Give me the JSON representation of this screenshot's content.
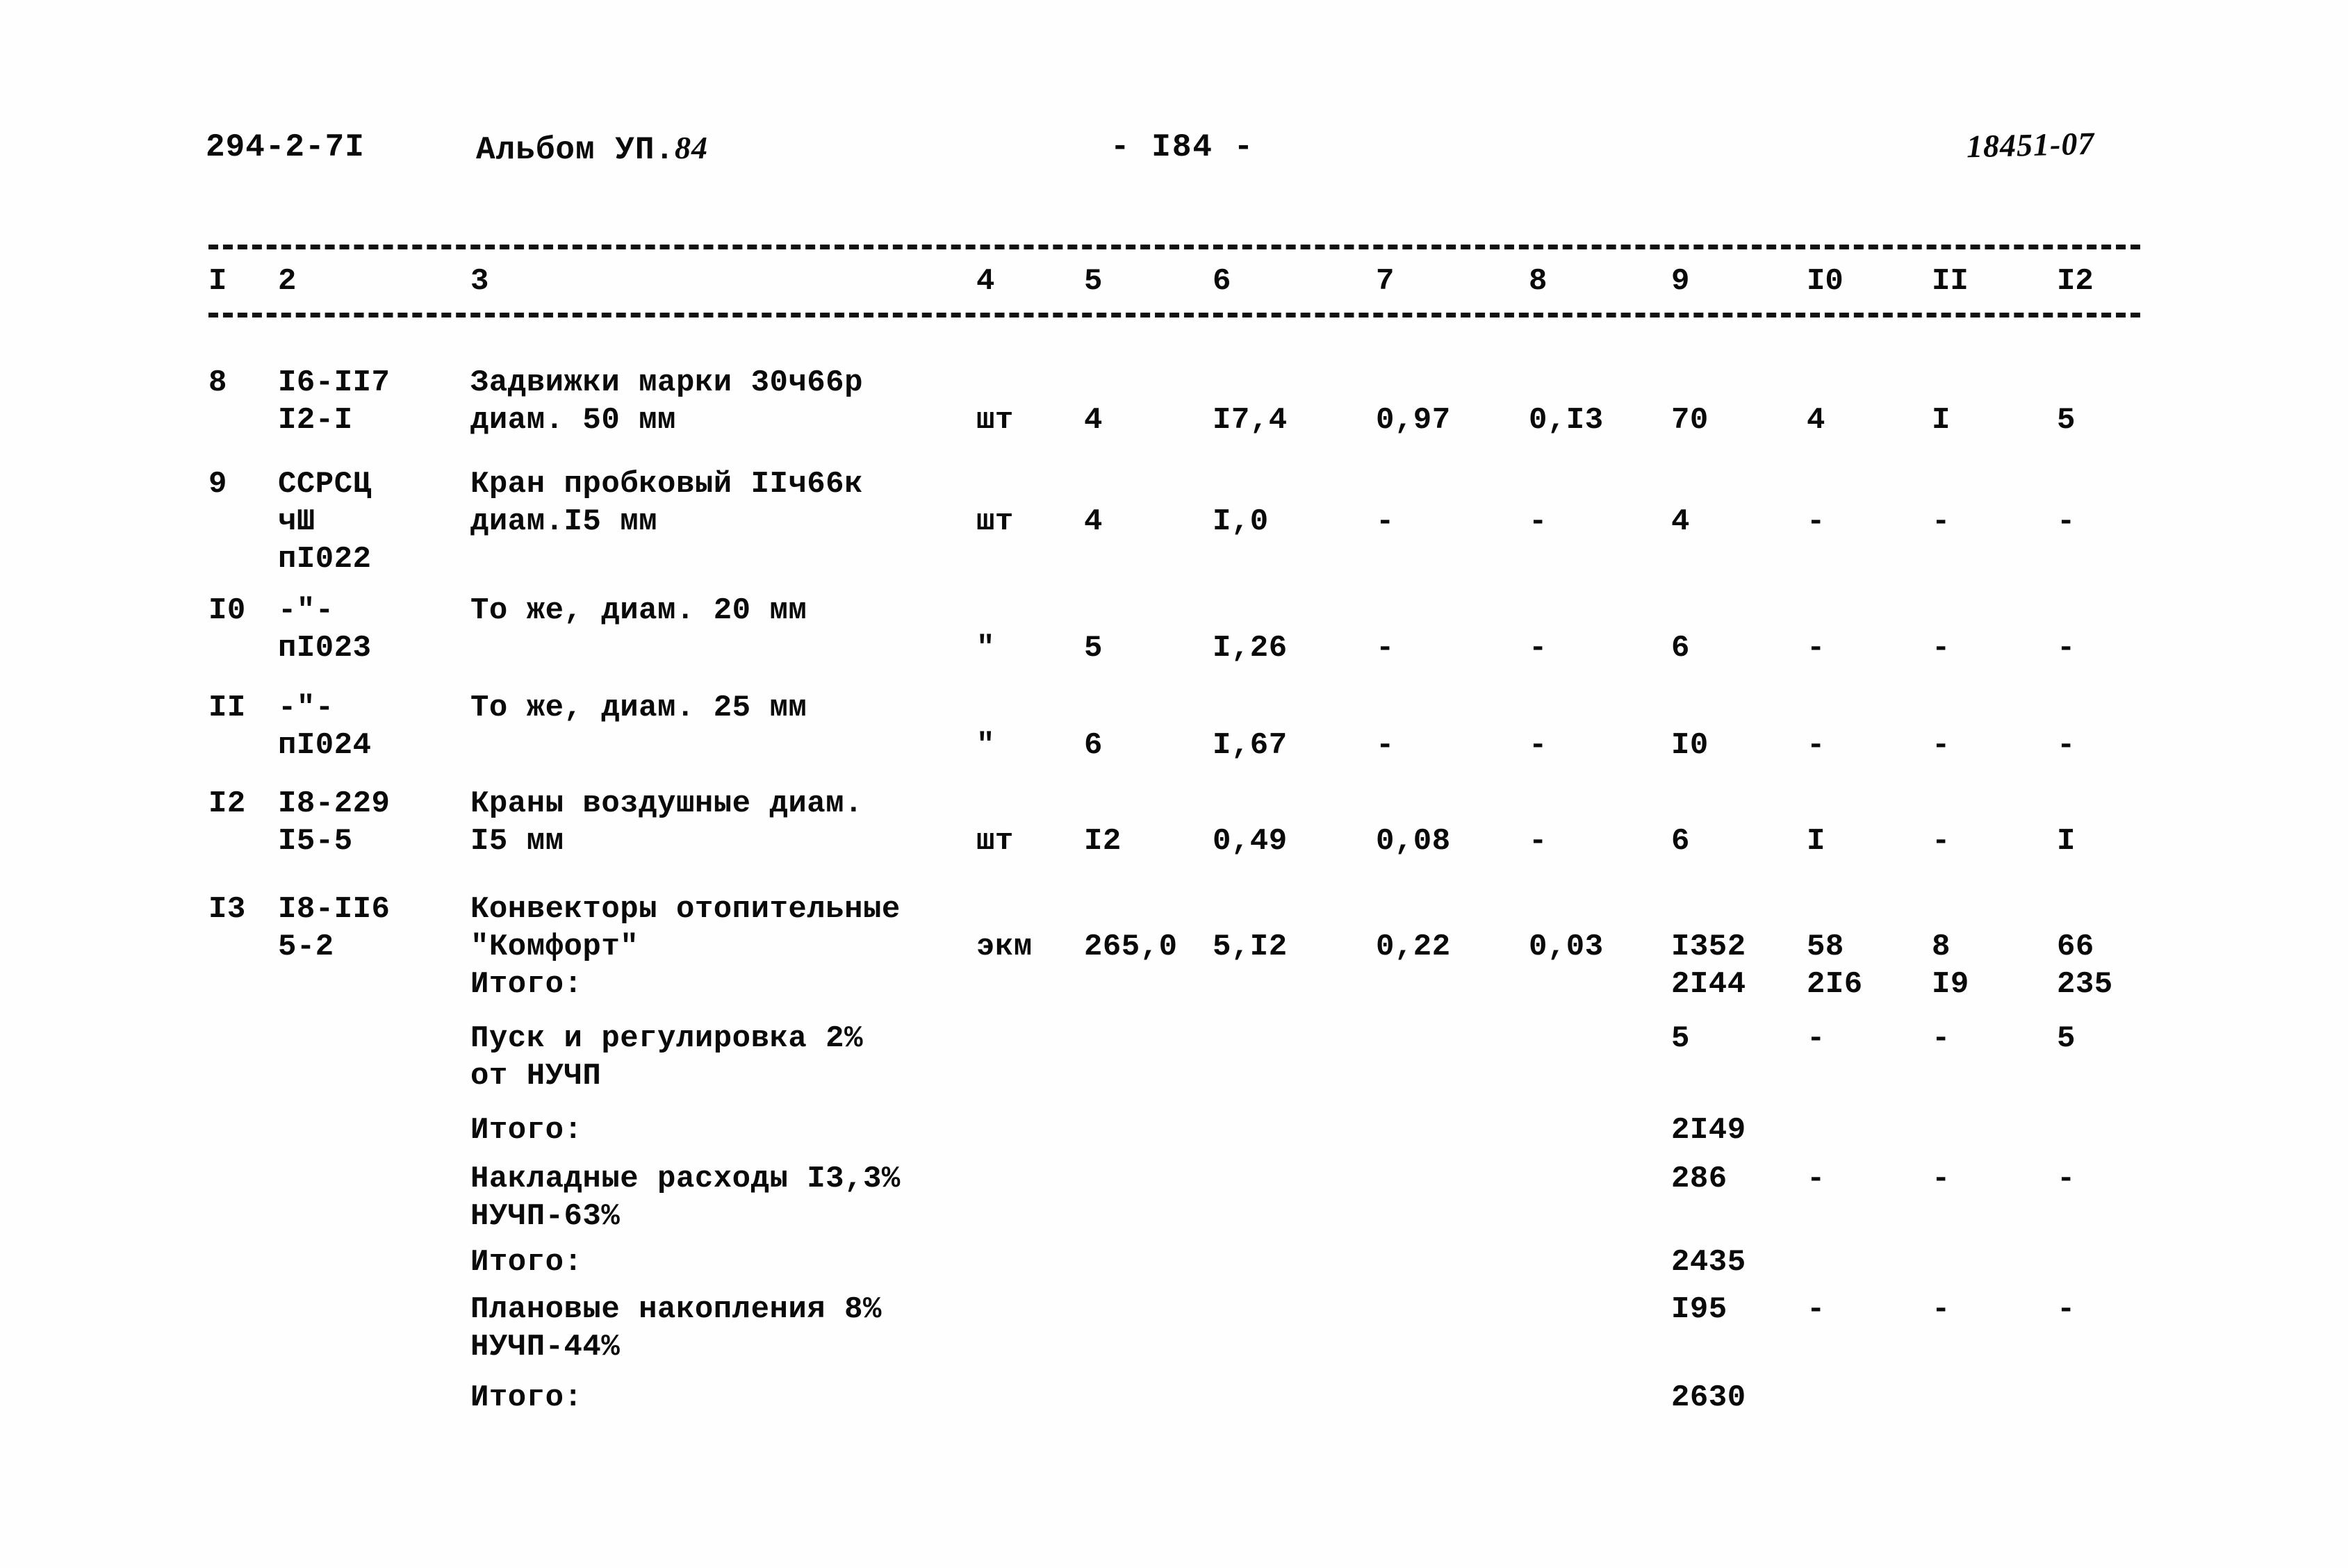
{
  "header": {
    "project_code": "294-2-7I",
    "album_label": "Альбом УП.",
    "album_number": "84",
    "page_marker": "- I84 -",
    "reference_no": "18451-07"
  },
  "table": {
    "column_headers": [
      "I",
      "2",
      "3",
      "4",
      "5",
      "6",
      "7",
      "8",
      "9",
      "I0",
      "II",
      "I2"
    ],
    "rows": [
      {
        "c1": "8",
        "c2": "I6-II7\nI2-I",
        "c3": "Задвижки марки 30ч66р\nдиам. 50 мм",
        "c4": "шт",
        "c5": "4",
        "c6": "I7,4",
        "c7": "0,97",
        "c8": "0,I3",
        "c9": "70",
        "c10": "4",
        "c11": "I",
        "c12": "5"
      },
      {
        "c1": "9",
        "c2": "ССРСЦ\nчШ\nпI022",
        "c3": "Кран пробковый IIч66к\nдиам.I5 мм",
        "c4": "шт",
        "c5": "4",
        "c6": "I,0",
        "c7": "-",
        "c8": "-",
        "c9": "4",
        "c10": "-",
        "c11": "-",
        "c12": "-"
      },
      {
        "c1": "I0",
        "c2": "-\"-\nпI023",
        "c3": "То же, диам. 20 мм",
        "c4": "\"",
        "c5": "5",
        "c6": "I,26",
        "c7": "-",
        "c8": "-",
        "c9": "6",
        "c10": "-",
        "c11": "-",
        "c12": "-"
      },
      {
        "c1": "II",
        "c2": "-\"-\nпI024",
        "c3": "То же, диам. 25 мм",
        "c4": "\"",
        "c5": "6",
        "c6": "I,67",
        "c7": "-",
        "c8": "-",
        "c9": "I0",
        "c10": "-",
        "c11": "-",
        "c12": "-"
      },
      {
        "c1": "I2",
        "c2": "I8-229\nI5-5",
        "c3": "Краны воздушные диам.\nI5 мм",
        "c4": "шт",
        "c5": "I2",
        "c6": "0,49",
        "c7": "0,08",
        "c8": "-",
        "c9": "6",
        "c10": "I",
        "c11": "-",
        "c12": "I"
      },
      {
        "c1": "I3",
        "c2": "I8-II6\n5-2",
        "c3": "Конвекторы отопительные\n\"Комфорт\"",
        "c4": "экм",
        "c5": "265,0",
        "c6": "5,I2",
        "c7": "0,22",
        "c8": "0,03",
        "c9": "I352",
        "c10": "58",
        "c11": "8",
        "c12": "66"
      }
    ],
    "summary_rows": [
      {
        "label": "Итого:",
        "c9": "2I44",
        "c10": "2I6",
        "c11": "I9",
        "c12": "235"
      },
      {
        "label": "Пуск и регулировка 2%\nот НУЧП",
        "c9": "5",
        "c10": "-",
        "c11": "-",
        "c12": "5"
      },
      {
        "label": "Итого:",
        "c9": "2I49",
        "c10": "",
        "c11": "",
        "c12": ""
      },
      {
        "label": "Накладные расходы I3,3%\nНУЧП-63%",
        "c9": "286",
        "c10": "-",
        "c11": "-",
        "c12": "-"
      },
      {
        "label": "Итого:",
        "c9": "2435",
        "c10": "",
        "c11": "",
        "c12": ""
      },
      {
        "label": "Плановые накопления 8%\nНУЧП-44%",
        "c9": "I95",
        "c10": "-",
        "c11": "-",
        "c12": "-"
      },
      {
        "label": "Итого:",
        "c9": "2630",
        "c10": "",
        "c11": "",
        "c12": ""
      }
    ]
  },
  "layout": {
    "col_x": {
      "c1": 300,
      "c2": 400,
      "c3": 677,
      "c4": 1405,
      "c5": 1560,
      "c6": 1745,
      "c7": 1980,
      "c8": 2200,
      "c9": 2405,
      "c10": 2600,
      "c11": 2780,
      "c12": 2960
    },
    "head_x": {
      "h1": 300,
      "h2": 400,
      "h3": 677,
      "h4": 1405,
      "h5": 1560,
      "h6": 1745,
      "h7": 1980,
      "h8": 2200,
      "h9": 2405,
      "h10": 2600,
      "h11": 2780,
      "h12": 2960
    },
    "row_y": [
      524,
      670,
      852,
      992,
      1130,
      1282
    ],
    "summary_y": [
      1390,
      1468,
      1600,
      1670,
      1790,
      1858,
      1985
    ],
    "summary_label_x": 677
  }
}
